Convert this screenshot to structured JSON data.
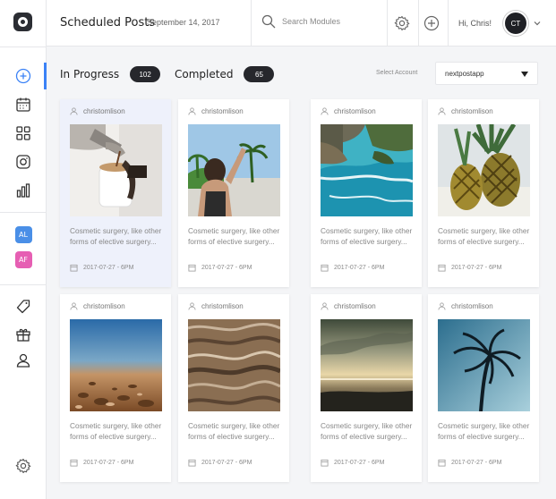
{
  "header": {
    "title": "Scheduled Posts",
    "date": "September 14, 2017",
    "search_placeholder": "Search Modules",
    "greeting": "Hi, Chris!",
    "avatar_initials": "CT"
  },
  "sidebar": {
    "accent": "#3b82f6",
    "accounts": [
      {
        "initials": "AL",
        "color": "#4a8fe7"
      },
      {
        "initials": "AF",
        "color": "#e65fb3"
      }
    ]
  },
  "tabs": [
    {
      "label": "In Progress",
      "count": "102"
    },
    {
      "label": "Completed",
      "count": "65"
    }
  ],
  "account_selector": {
    "label": "Select Account",
    "value": "nextpostapp"
  },
  "posts": [
    {
      "user": "christomlison",
      "caption": "Cosmetic surgery, like other forms of elective surgery...",
      "date": "2017-07-27 - 6PM",
      "image": "coffee-pour"
    },
    {
      "user": "christomlison",
      "caption": "Cosmetic surgery, like other forms of elective surgery...",
      "date": "2017-07-27 - 6PM",
      "image": "beach-girl"
    },
    {
      "user": "christomlison",
      "caption": "Cosmetic surgery, like other forms of elective surgery...",
      "date": "2017-07-27 - 6PM",
      "image": "coastal-cliffs"
    },
    {
      "user": "christomlison",
      "caption": "Cosmetic surgery, like other forms of elective surgery...",
      "date": "2017-07-27 - 6PM",
      "image": "pineapples"
    },
    {
      "user": "christomlison",
      "caption": "Cosmetic surgery, like other forms of elective surgery...",
      "date": "2017-07-27 - 6PM",
      "image": "pebble-beach"
    },
    {
      "user": "christomlison",
      "caption": "Cosmetic surgery, like other forms of elective surgery...",
      "date": "2017-07-27 - 6PM",
      "image": "sand-waves"
    },
    {
      "user": "christomlison",
      "caption": "Cosmetic surgery, like other forms of elective surgery...",
      "date": "2017-07-27 - 6PM",
      "image": "sea-sunset"
    },
    {
      "user": "christomlison",
      "caption": "Cosmetic surgery, like other forms of elective surgery...",
      "date": "2017-07-27 - 6PM",
      "image": "palm-tree"
    }
  ]
}
